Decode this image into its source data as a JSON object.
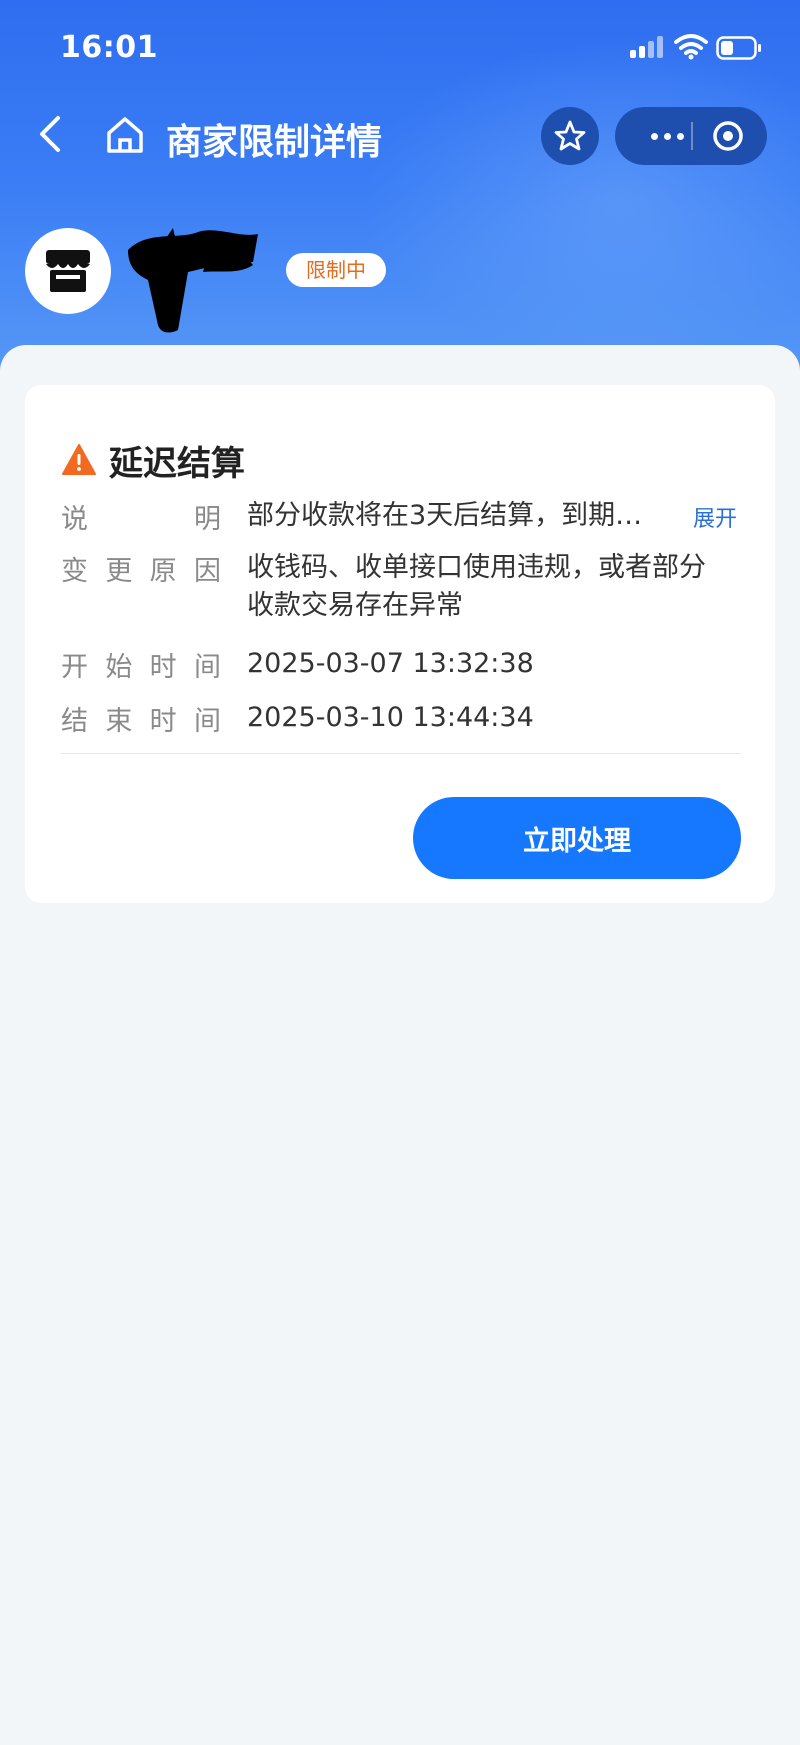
{
  "status_bar": {
    "time": "16:01"
  },
  "nav": {
    "title": "商家限制详情",
    "icons": [
      "back-icon",
      "home-icon",
      "star-icon",
      "more-icon",
      "target-icon"
    ]
  },
  "merchant": {
    "badge": "限制中",
    "avatar_icon": "store-icon"
  },
  "card": {
    "title": "延迟结算",
    "title_icon": "warning-icon",
    "rows": [
      {
        "label": "说明",
        "value": "部分收款将在3天后结算，到期…",
        "action": "展开"
      },
      {
        "label": "变更原因",
        "value": "收钱码、收单接口使用违规，或者部分收款交易存在异常"
      },
      {
        "label": "开始时间",
        "value": "2025-03-07 13:32:38"
      },
      {
        "label": "结束时间",
        "value": "2025-03-10 13:44:34"
      }
    ],
    "button": "立即处理"
  },
  "colors": {
    "header": "#2f6ef0",
    "accent": "#1677ff",
    "warning": "#f26a1f",
    "badge_text": "#e86a1e"
  }
}
